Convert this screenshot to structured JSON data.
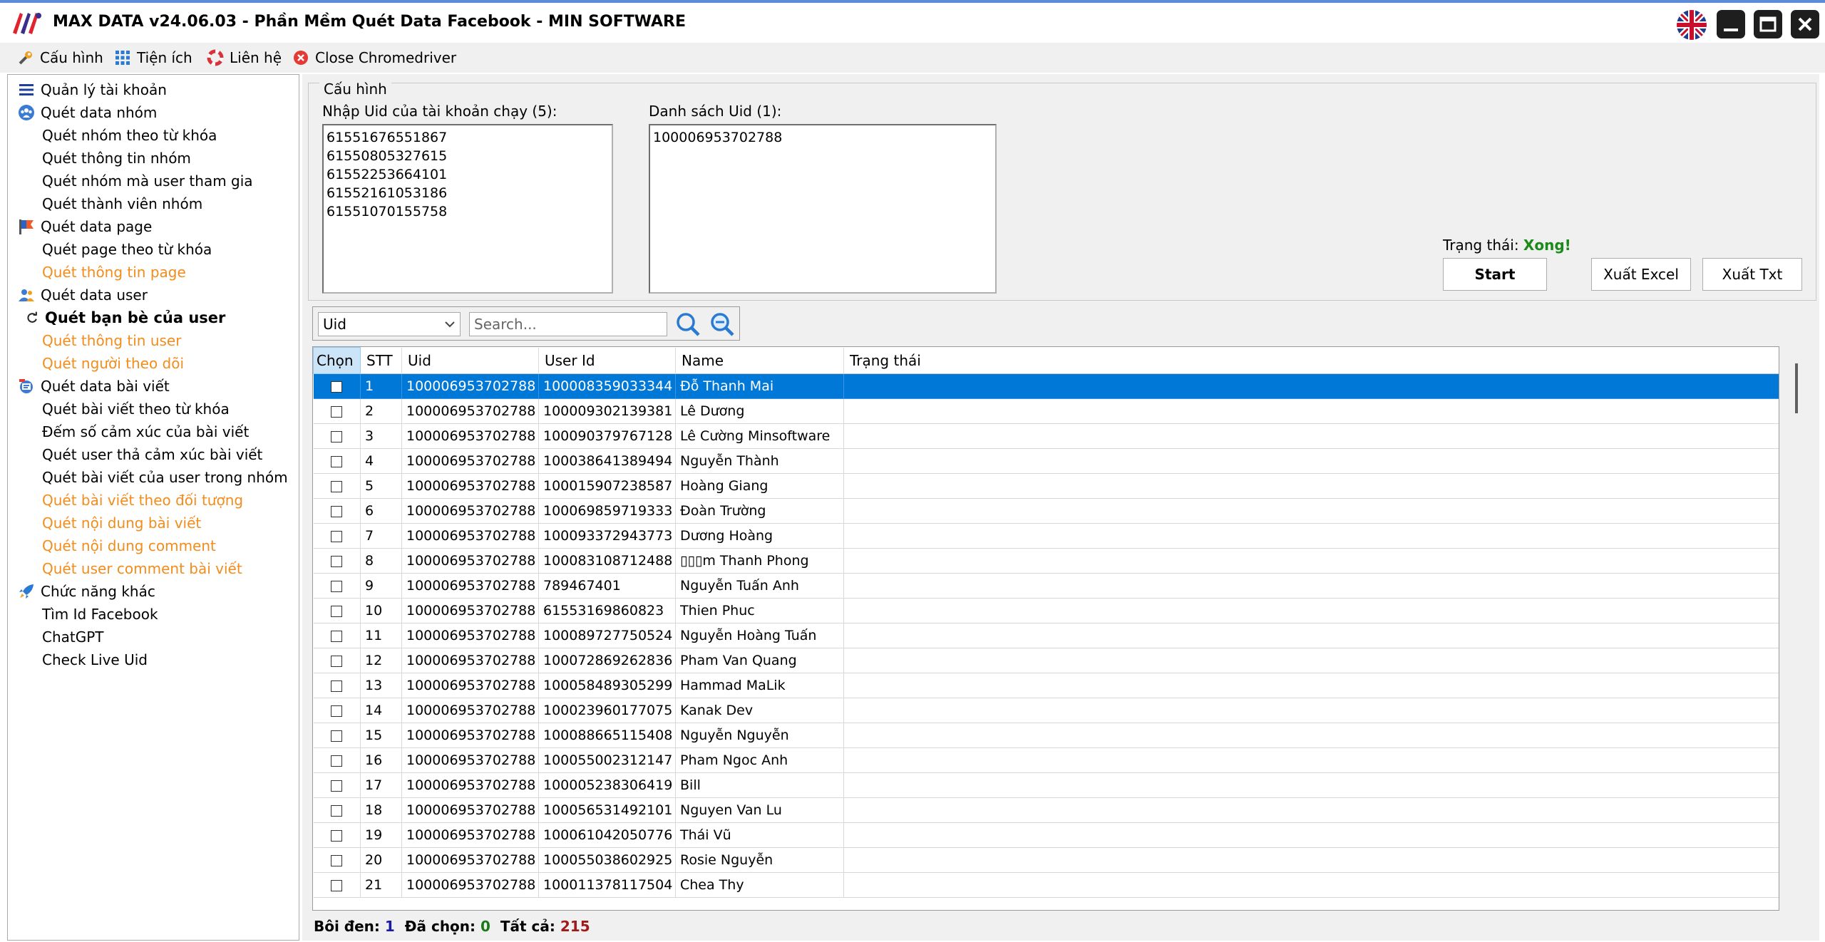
{
  "window": {
    "title": "MAX DATA v24.06.03 - Phần Mềm Quét Data Facebook - MIN SOFTWARE"
  },
  "menu": [
    {
      "label": "Cấu hình",
      "icon": "wrench-icon"
    },
    {
      "label": "Tiện ích",
      "icon": "grid-icon"
    },
    {
      "label": "Liên hệ",
      "icon": "lifebuoy-icon"
    },
    {
      "label": "Close Chromedriver",
      "icon": "close-circle-icon"
    }
  ],
  "sidebar": {
    "items": [
      {
        "label": "Quản lý tài khoản",
        "type": "cat",
        "icon": "list-icon"
      },
      {
        "label": "Quét data nhóm",
        "type": "cat",
        "icon": "group-icon"
      },
      {
        "label": "Quét nhóm theo từ khóa",
        "type": "sub"
      },
      {
        "label": "Quét thông tin nhóm",
        "type": "sub"
      },
      {
        "label": "Quét nhóm mà user tham gia",
        "type": "sub"
      },
      {
        "label": "Quét thành viên nhóm",
        "type": "sub"
      },
      {
        "label": "Quét data page",
        "type": "cat",
        "icon": "flag-icon"
      },
      {
        "label": "Quét page theo từ khóa",
        "type": "sub"
      },
      {
        "label": "Quét thông tin page",
        "type": "sub-orange"
      },
      {
        "label": "Quét data user",
        "type": "cat",
        "icon": "users-icon"
      },
      {
        "label": "Quét bạn bè của user",
        "type": "sub-bold",
        "icon": "refresh-icon"
      },
      {
        "label": "Quét thông tin user",
        "type": "sub-orange"
      },
      {
        "label": "Quét người theo dõi",
        "type": "sub-orange"
      },
      {
        "label": "Quét data bài viết",
        "type": "cat",
        "icon": "post-icon"
      },
      {
        "label": "Quét bài viết theo từ khóa",
        "type": "sub"
      },
      {
        "label": "Đếm số cảm xúc của bài viết",
        "type": "sub"
      },
      {
        "label": "Quét user thả cảm xúc bài viết",
        "type": "sub"
      },
      {
        "label": "Quét bài viết của user trong nhóm",
        "type": "sub"
      },
      {
        "label": "Quét bài viết theo đối tượng",
        "type": "sub-orange"
      },
      {
        "label": "Quét nội dung bài viết",
        "type": "sub-orange"
      },
      {
        "label": "Quét nội dung comment",
        "type": "sub-orange"
      },
      {
        "label": "Quét user comment bài viết",
        "type": "sub-orange"
      },
      {
        "label": "Chức năng khác",
        "type": "cat",
        "icon": "rocket-icon"
      },
      {
        "label": "Tìm Id Facebook",
        "type": "sub"
      },
      {
        "label": "ChatGPT",
        "type": "sub"
      },
      {
        "label": "Check Live Uid",
        "type": "sub"
      }
    ]
  },
  "config": {
    "group_title": "Cấu hình",
    "uid_accounts_label": "Nhập Uid của tài khoản chạy (5):",
    "uid_accounts_value": "61551676551867\n61550805327615\n61552253664101\n61552161053186\n61551070155758",
    "uid_list_label": "Danh sách Uid (1):",
    "uid_list_value": "100006953702788",
    "status_label": "Trạng thái:",
    "status_value": "Xong!",
    "start_label": "Start",
    "export_excel_label": "Xuất Excel",
    "export_txt_label": "Xuất Txt"
  },
  "search": {
    "filter_value": "Uid",
    "placeholder": "Search..."
  },
  "table": {
    "columns": [
      "Chọn",
      "STT",
      "Uid",
      "User Id",
      "Name",
      "Trạng thái"
    ],
    "rows": [
      {
        "stt": "1",
        "uid": "100006953702788",
        "user_id": "100008359033344",
        "name": "Đỗ Thanh Mai",
        "status": ""
      },
      {
        "stt": "2",
        "uid": "100006953702788",
        "user_id": "100009302139381",
        "name": "Lê Dương",
        "status": ""
      },
      {
        "stt": "3",
        "uid": "100006953702788",
        "user_id": "100090379767128",
        "name": "Lê Cường Minsoftware",
        "status": ""
      },
      {
        "stt": "4",
        "uid": "100006953702788",
        "user_id": "100038641389494",
        "name": "Nguyễn Thành",
        "status": ""
      },
      {
        "stt": "5",
        "uid": "100006953702788",
        "user_id": "100015907238587",
        "name": "Hoàng Giang",
        "status": ""
      },
      {
        "stt": "6",
        "uid": "100006953702788",
        "user_id": "100069859719333",
        "name": "Đoàn Trường",
        "status": ""
      },
      {
        "stt": "7",
        "uid": "100006953702788",
        "user_id": "100093372943773",
        "name": "Dương Hoàng",
        "status": ""
      },
      {
        "stt": "8",
        "uid": "100006953702788",
        "user_id": "100083108712488",
        "name": "▯▯▯m Thanh Phong",
        "status": ""
      },
      {
        "stt": "9",
        "uid": "100006953702788",
        "user_id": "789467401",
        "name": "Nguyễn Tuấn Anh",
        "status": ""
      },
      {
        "stt": "10",
        "uid": "100006953702788",
        "user_id": "61553169860823",
        "name": "Thien Phuc",
        "status": ""
      },
      {
        "stt": "11",
        "uid": "100006953702788",
        "user_id": "100089727750524",
        "name": "Nguyễn Hoàng Tuấn",
        "status": ""
      },
      {
        "stt": "12",
        "uid": "100006953702788",
        "user_id": "100072869262836",
        "name": "Pham Van Quang",
        "status": ""
      },
      {
        "stt": "13",
        "uid": "100006953702788",
        "user_id": "100058489305299",
        "name": "Hammad MaLik",
        "status": ""
      },
      {
        "stt": "14",
        "uid": "100006953702788",
        "user_id": "100023960177075",
        "name": "Kanak Dev",
        "status": ""
      },
      {
        "stt": "15",
        "uid": "100006953702788",
        "user_id": "100088665115408",
        "name": "Nguyễn Nguyễn",
        "status": ""
      },
      {
        "stt": "16",
        "uid": "100006953702788",
        "user_id": "100055002312147",
        "name": "Pham Ngoc Anh",
        "status": ""
      },
      {
        "stt": "17",
        "uid": "100006953702788",
        "user_id": "100005238306419",
        "name": "Bill",
        "status": ""
      },
      {
        "stt": "18",
        "uid": "100006953702788",
        "user_id": "100056531492101",
        "name": "Nguyen Van Lu",
        "status": ""
      },
      {
        "stt": "19",
        "uid": "100006953702788",
        "user_id": "100061042050776",
        "name": "Thái Vũ",
        "status": ""
      },
      {
        "stt": "20",
        "uid": "100006953702788",
        "user_id": "100055038602925",
        "name": "Rosie Nguyễn",
        "status": ""
      },
      {
        "stt": "21",
        "uid": "100006953702788",
        "user_id": "100011378117504",
        "name": "Chea Thy",
        "status": ""
      }
    ]
  },
  "footer": {
    "highlighted_label": "Bôi đen:",
    "highlighted_value": "1",
    "selected_label": "Đã chọn:",
    "selected_value": "0",
    "total_label": "Tất cả:",
    "total_value": "215"
  }
}
